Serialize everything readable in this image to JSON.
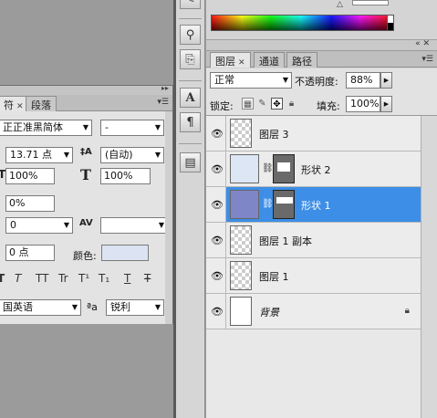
{
  "right_panel": {
    "color_slider_value": "",
    "tabs": [
      {
        "label": "图层",
        "closable": true,
        "active": true
      },
      {
        "label": "通道",
        "closable": false,
        "active": false
      },
      {
        "label": "路径",
        "closable": false,
        "active": false
      }
    ],
    "blend_mode": "正常",
    "opacity_label": "不透明度:",
    "opacity_value": "88%",
    "lock_label": "锁定:",
    "fill_label": "填充:",
    "fill_value": "100%",
    "layers": [
      {
        "name": "图层 3",
        "thumb": "checker",
        "visible": true,
        "selected": false
      },
      {
        "name": "形状 2",
        "thumb": "shape-light",
        "visible": true,
        "selected": false
      },
      {
        "name": "形状 1",
        "thumb": "shape-blue",
        "visible": true,
        "selected": true
      },
      {
        "name": "图层 1 副本",
        "thumb": "checker",
        "visible": true,
        "selected": false
      },
      {
        "name": "图层 1",
        "thumb": "checker",
        "visible": true,
        "selected": false
      },
      {
        "name": "背景",
        "thumb": "white",
        "visible": true,
        "selected": false,
        "locked": true
      }
    ],
    "colors": {
      "selected_layer": "#3d8ee6",
      "shape1_thumb": "#7f86c8",
      "shape2_thumb": "#dce6f5"
    }
  },
  "char_panel": {
    "tabs": [
      {
        "label": "符",
        "closable": true,
        "active": true
      },
      {
        "label": "段落",
        "closable": false,
        "active": false
      }
    ],
    "font_family": "正正准黑简体",
    "font_style": "-",
    "font_size": "13.71 点",
    "leading": "(自动)",
    "vertical_scale": "100%",
    "horizontal_scale": "100%",
    "tracking": "0%",
    "kerning": "0",
    "baseline_shift": "0 点",
    "color_label": "颜色:",
    "color_swatch": "#dce3f2",
    "format_buttons": [
      "T",
      "T",
      "TT",
      "Tr",
      "T¹",
      "T₁",
      "T",
      "Ŧ"
    ],
    "language": "国英语",
    "antialias_icon": "ªa",
    "antialias": "锐利"
  }
}
